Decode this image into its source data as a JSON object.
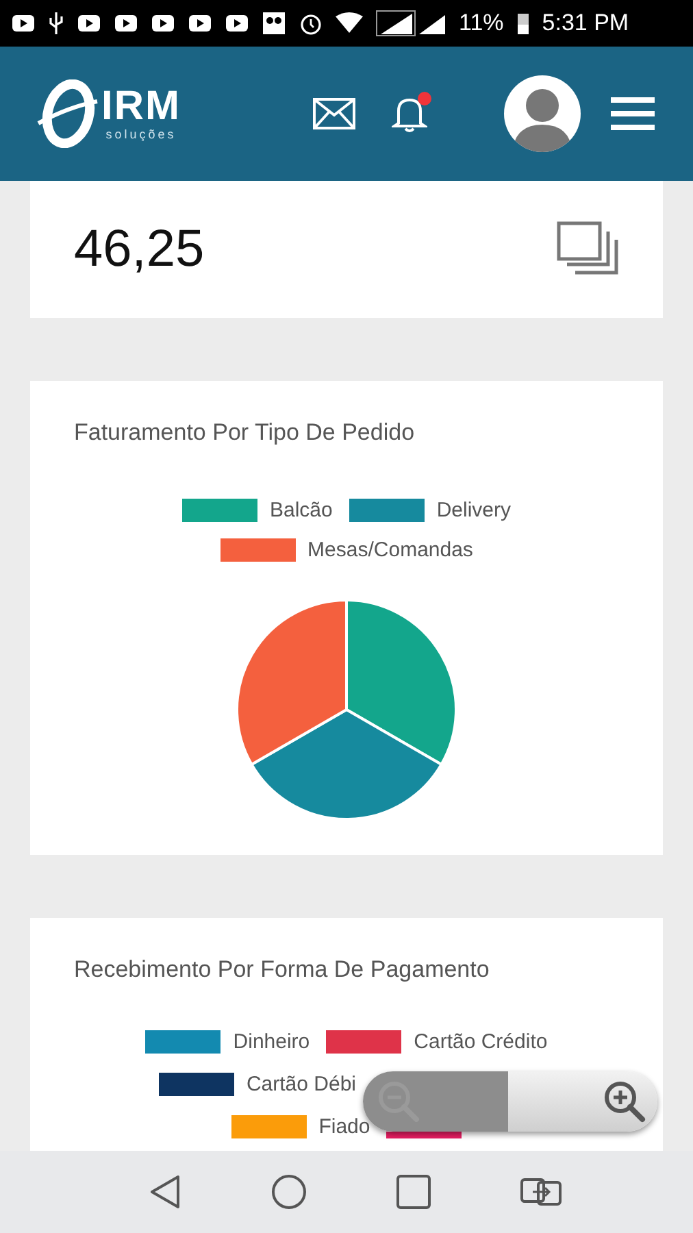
{
  "status_bar": {
    "battery": "11%",
    "time": "5:31 PM"
  },
  "header": {
    "brand": "IRM",
    "brand_sub": "soluções",
    "notification_badge": true
  },
  "value_card": {
    "value": "46,25"
  },
  "charts": [
    {
      "title": "Faturamento Por Tipo De Pedido",
      "legend_rows": [
        {
          "items": [
            {
              "label": "Balcão",
              "color": "#13a68c"
            },
            {
              "label": "Delivery",
              "color": "#168a9e"
            }
          ]
        },
        {
          "items": [
            {
              "label": "Mesas/Comandas",
              "color": "#f4603e"
            }
          ]
        }
      ]
    },
    {
      "title": "Recebimento Por Forma De Pagamento",
      "legend_rows": [
        {
          "items": [
            {
              "label": "Dinheiro",
              "color": "#138ab0"
            },
            {
              "label": "Cartão Crédito",
              "color": "#df3349"
            }
          ]
        },
        {
          "items": [
            {
              "label": "Cartão Débi",
              "color": "#0e3461"
            }
          ]
        },
        {
          "items": [
            {
              "label": "Fiado",
              "color": "#fb9c0a"
            },
            {
              "color": "#e91e63"
            }
          ]
        }
      ]
    }
  ]
}
